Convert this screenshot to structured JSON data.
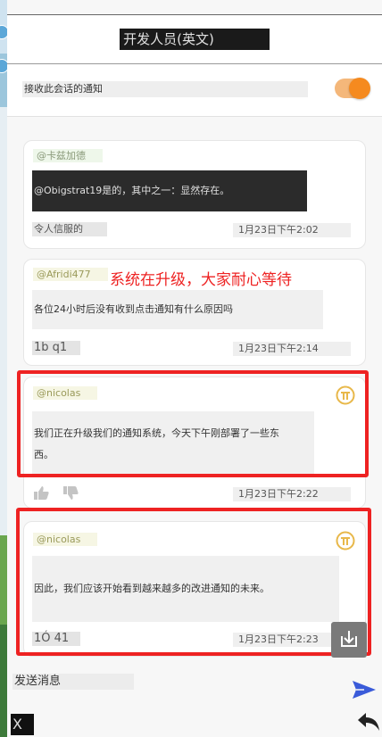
{
  "header": {
    "title": "开发人员(英文)"
  },
  "notify": {
    "label": "接收此会话的通知",
    "enabled": true
  },
  "messages": [
    {
      "handle": "@卡兹加德",
      "text": "@Obigstrat19是的，其中之一：显然存在。",
      "reaction": "令人信服的",
      "time": "1月23日下午2:02"
    },
    {
      "handle": "@Afridi477",
      "text": "各位24小时后没有收到点击通知有什么原因吗",
      "reaction": "1b q1",
      "time": "1月23日下午2:14"
    },
    {
      "handle": "@nicolas",
      "text_line1": "我们正在升级我们的通知系统，今天下午刚部署了一些东",
      "text_line2": "西。",
      "time": "1月23日下午2:22"
    },
    {
      "handle": "@nicolas",
      "text": "因此，我们应该开始看到越来越多的改进通知的未来。",
      "reaction": "1Ó 41",
      "time": "1月23日下午2:23"
    }
  ],
  "annotation": {
    "text": "系统在升级，大家耐心等待"
  },
  "composer": {
    "placeholder": "发送消息",
    "x_label": "X"
  },
  "colors": {
    "accent_orange": "#f58a1f",
    "annotation_red": "#ee2222",
    "send_blue": "#3a5bd9",
    "pi_gold": "#e8b84a"
  },
  "icons": [
    "pi-coin-icon",
    "thumbs-up-icon",
    "thumbs-down-icon",
    "download-icon",
    "send-icon",
    "back-arrow-icon"
  ]
}
